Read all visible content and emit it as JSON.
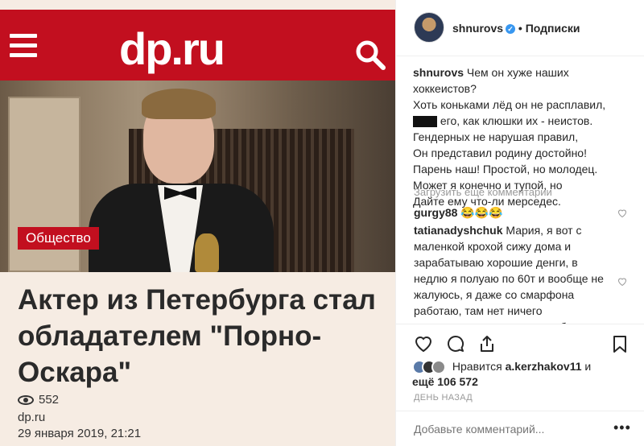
{
  "post_image": {
    "logo": "dp.ru",
    "category_badge": "Общество",
    "headline": "Актер из Петербурга стал обладателем \"Порно-Оскара\"",
    "views": "552",
    "source": "dp.ru",
    "date": "29 января 2019, 21:21"
  },
  "panel": {
    "username": "shnurovs",
    "separator": "•",
    "follow_label": "Подписки",
    "caption": {
      "author": "shnurovs",
      "lines": [
        "Чем он хуже наших",
        "хоккеистов?",
        "Хоть коньками лёд он не расплавил,",
        "его, как клюшки их - неистов.",
        "Гендерных не нарушая правил,",
        "Он представил родину достойно!",
        "Парень наш! Простой, но молодец.",
        "Может я конечно и тупой, но",
        "Дайте ему что-ли мерседес."
      ]
    },
    "load_more": "Загрузить еще комментарии",
    "comments": [
      {
        "author": "gurgy88",
        "text": "😂😂😂"
      },
      {
        "author": "tatianadyshchuk",
        "text": "Мария, я вот с маленкой крохой сижу дома и зарабатываю хорошие денги, в недлю я полуаю по 60т и вообще не жалуюсь, я даже со смарфона работаю, там нет ничего сверхсложного, главное чтоб в наличии было, если у вас есть"
      }
    ],
    "likes": {
      "prefix": "Нравится",
      "user": "a.kerzhakov11",
      "middle": "и",
      "more": "ещё 106 572"
    },
    "time_ago": "ДЕНЬ НАЗАД",
    "add_comment_placeholder": "Добавьте комментарий...",
    "more_dots": "•••"
  },
  "colors": {
    "brand_red": "#c20f1f",
    "verified_blue": "#3897f0",
    "muted": "#999999"
  }
}
